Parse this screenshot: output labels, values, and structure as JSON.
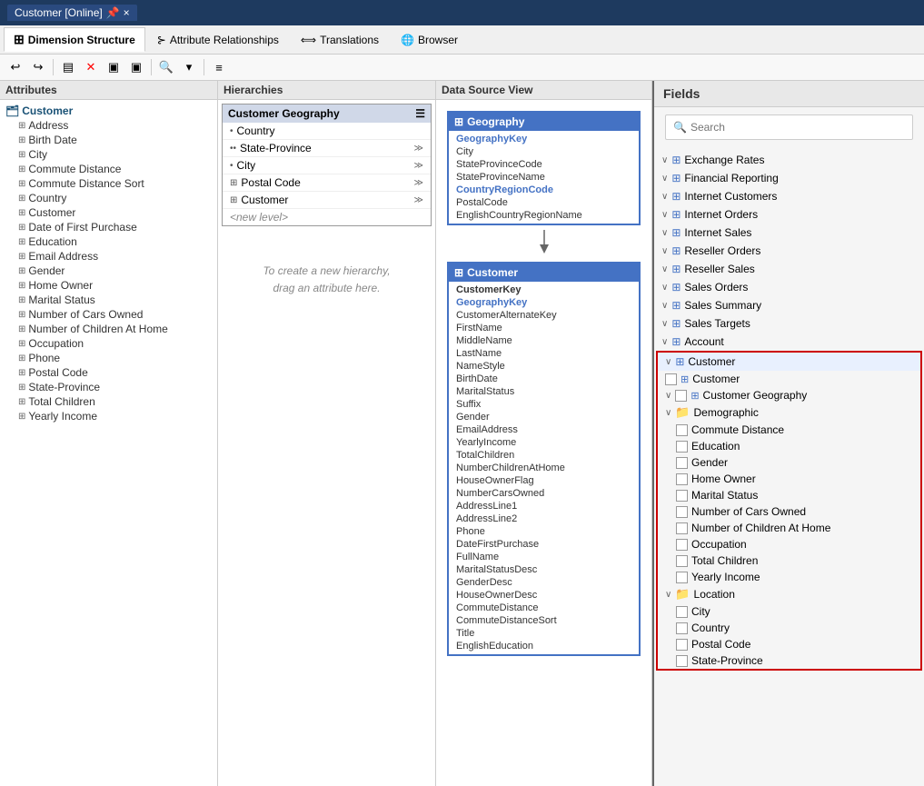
{
  "titlebar": {
    "title": "Customer [Online]",
    "close_label": "×",
    "pin_label": "📌"
  },
  "ribbon": {
    "tabs": [
      {
        "id": "dimension-structure",
        "label": "Dimension Structure",
        "active": true
      },
      {
        "id": "attribute-relationships",
        "label": "Attribute Relationships"
      },
      {
        "id": "translations",
        "label": "Translations"
      },
      {
        "id": "browser",
        "label": "Browser"
      }
    ],
    "toolbar_icons": [
      "↩",
      "↪",
      "▤",
      "✕",
      "▣",
      "▣",
      "▤",
      "🔍",
      "▾",
      "≡"
    ]
  },
  "panes": {
    "attributes": {
      "header": "Attributes",
      "root": "Customer",
      "items": [
        "Address",
        "Birth Date",
        "City",
        "Commute Distance",
        "Commute Distance Sort",
        "Country",
        "Customer",
        "Date of First Purchase",
        "Education",
        "Email Address",
        "Gender",
        "Home Owner",
        "Marital Status",
        "Number of Cars Owned",
        "Number of Children At Home",
        "Occupation",
        "Phone",
        "Postal Code",
        "State-Province",
        "Total Children",
        "Yearly Income"
      ]
    },
    "hierarchies": {
      "header": "Hierarchies",
      "hierarchy": {
        "name": "Customer Geography",
        "items": [
          "Country",
          "State-Province",
          "City",
          "Postal Code",
          "Customer"
        ],
        "new_level": "<new level>"
      },
      "drag_text": "To create a new hierarchy,\ndrag an attribute here."
    },
    "datasource": {
      "header": "Data Source View",
      "tables": [
        {
          "name": "Geography",
          "rows": [
            {
              "text": "GeographyKey",
              "highlight": true
            },
            {
              "text": "City"
            },
            {
              "text": "StateProvinceCode"
            },
            {
              "text": "StateProvinceName"
            },
            {
              "text": "CountryRegionCode",
              "highlight": true
            },
            {
              "text": "PostalCode"
            },
            {
              "text": "EnglishCountryRegionName"
            }
          ]
        },
        {
          "name": "Customer",
          "rows": [
            {
              "text": "CustomerKey",
              "bold": true
            },
            {
              "text": "GeographyKey",
              "highlight": true
            },
            {
              "text": "CustomerAlternateKey"
            },
            {
              "text": "FirstName"
            },
            {
              "text": "MiddleName"
            },
            {
              "text": "LastName"
            },
            {
              "text": "NameStyle"
            },
            {
              "text": "BirthDate"
            },
            {
              "text": "MaritalStatus"
            },
            {
              "text": "Suffix"
            },
            {
              "text": "Gender"
            },
            {
              "text": "EmailAddress"
            },
            {
              "text": "YearlyIncome"
            },
            {
              "text": "TotalChildren"
            },
            {
              "text": "NumberChildrenAtHome"
            },
            {
              "text": "HouseOwnerFlag"
            },
            {
              "text": "NumberCarsOwned"
            },
            {
              "text": "AddressLine1"
            },
            {
              "text": "AddressLine2"
            },
            {
              "text": "Phone"
            },
            {
              "text": "DateFirstPurchase"
            },
            {
              "text": "FullName"
            },
            {
              "text": "MaritalStatusDesc"
            },
            {
              "text": "GenderDesc"
            },
            {
              "text": "HouseOwnerDesc"
            },
            {
              "text": "CommuteDistance"
            },
            {
              "text": "CommuteDistanceSort"
            },
            {
              "text": "Title"
            },
            {
              "text": "EnglishEducation"
            }
          ]
        }
      ]
    }
  },
  "fields": {
    "header": "Fields",
    "search_placeholder": "Search",
    "groups": [
      {
        "label": "Exchange Rates",
        "expanded": true,
        "icon": "table"
      },
      {
        "label": "Financial Reporting",
        "expanded": true,
        "icon": "table"
      },
      {
        "label": "Internet Customers",
        "expanded": true,
        "icon": "table"
      },
      {
        "label": "Internet Orders",
        "expanded": true,
        "icon": "table"
      },
      {
        "label": "Internet Sales",
        "expanded": true,
        "icon": "table"
      },
      {
        "label": "Reseller Orders",
        "expanded": true,
        "icon": "table"
      },
      {
        "label": "Reseller Sales",
        "expanded": true,
        "icon": "table"
      },
      {
        "label": "Sales Orders",
        "expanded": true,
        "icon": "table"
      },
      {
        "label": "Sales Summary",
        "expanded": true,
        "icon": "table"
      },
      {
        "label": "Sales Targets",
        "expanded": true,
        "icon": "table"
      },
      {
        "label": "Account",
        "expanded": true,
        "icon": "table"
      },
      {
        "label": "Customer",
        "expanded": true,
        "icon": "table",
        "highlighted": true,
        "children": [
          {
            "label": "Customer",
            "type": "sub-table",
            "checkbox": true
          },
          {
            "label": "Customer Geography",
            "type": "hierarchy",
            "checkbox": true,
            "expanded": true
          },
          {
            "label": "Demographic",
            "type": "folder",
            "expanded": true,
            "children": [
              "Commute Distance",
              "Education",
              "Gender",
              "Home Owner",
              "Marital Status",
              "Number of Cars Owned",
              "Number of Children At Home",
              "Occupation",
              "Total Children",
              "Yearly Income"
            ]
          },
          {
            "label": "Location",
            "type": "folder",
            "expanded": true,
            "children": [
              "City",
              "Country",
              "Postal Code",
              "State-Province"
            ]
          }
        ]
      }
    ]
  }
}
